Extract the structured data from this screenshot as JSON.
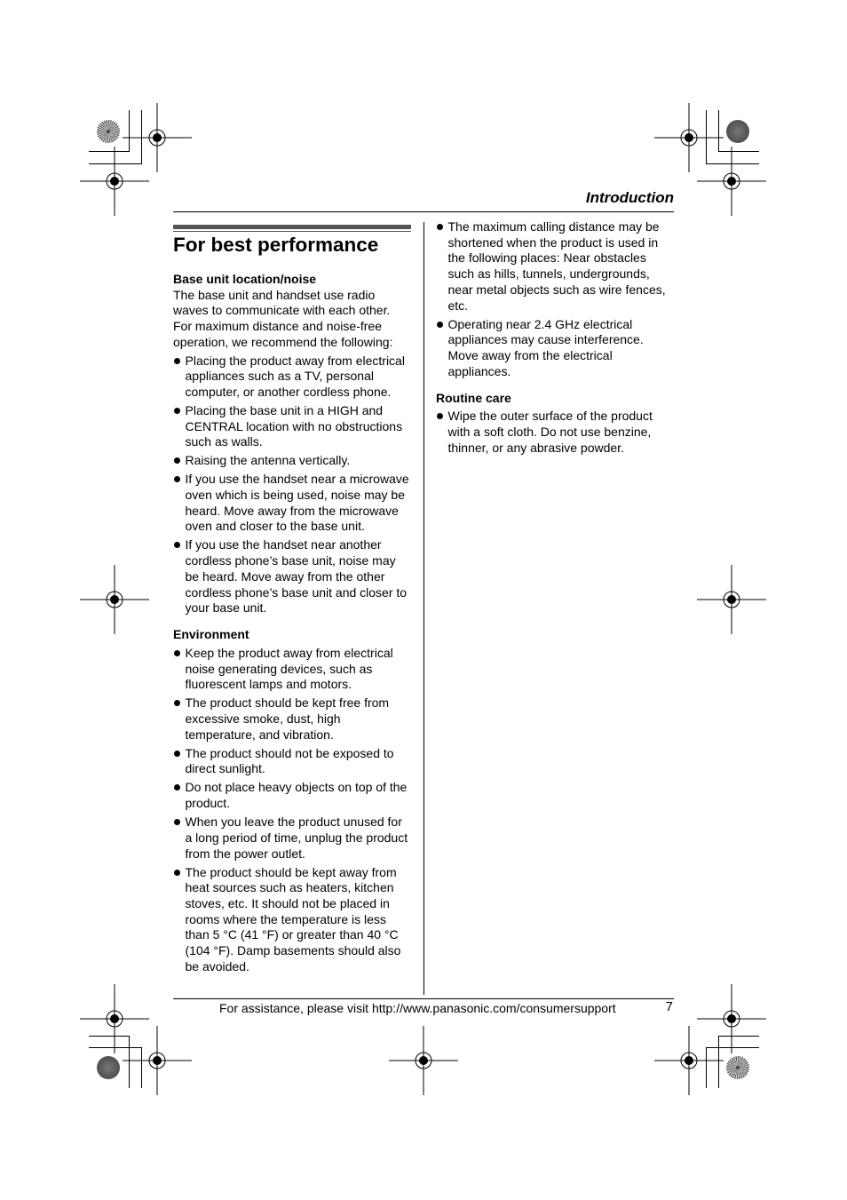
{
  "header": {
    "section_title": "Introduction"
  },
  "page_title": "For best performance",
  "left_column": {
    "base_unit": {
      "heading": "Base unit location/noise",
      "intro": "The base unit and handset use radio waves to communicate with each other. For maximum distance and noise-free operation, we recommend the following:",
      "bullets": [
        "Placing the product away from electrical appliances such as a TV, personal computer, or another cordless phone.",
        "Placing the base unit in a HIGH and CENTRAL location with no obstructions such as walls.",
        "Raising the antenna vertically.",
        "If you use the handset near a microwave oven which is being used, noise may be heard. Move away from the microwave oven and closer to the base unit.",
        "If you use the handset near another cordless phone’s base unit, noise may be heard. Move away from the other cordless phone’s base unit and closer to your base unit."
      ]
    },
    "environment": {
      "heading": "Environment",
      "bullets": [
        "Keep the product away from electrical noise generating devices, such as fluorescent lamps and motors.",
        "The product should be kept free from excessive smoke, dust, high temperature, and vibration.",
        "The product should not be exposed to direct sunlight.",
        "Do not place heavy objects on top of the product.",
        "When you leave the product unused for a long period of time, unplug the product from the power outlet.",
        "The product should be kept away from heat sources such as heaters, kitchen stoves, etc. It should not be placed in rooms where the temperature is less than 5 °C (41 °F) or greater than 40 °C (104 °F). Damp basements should also be avoided."
      ]
    }
  },
  "right_column": {
    "bullets": [
      "The maximum calling distance may be shortened when the product is used in the following places: Near obstacles such as hills, tunnels, undergrounds, near metal objects such as wire fences, etc.",
      "Operating near 2.4 GHz electrical appliances may cause interference. Move away from the electrical appliances."
    ],
    "routine_care": {
      "heading": "Routine care",
      "bullets": [
        "Wipe the outer surface of the product with a soft cloth. Do not use benzine, thinner, or any abrasive powder."
      ]
    }
  },
  "footer": {
    "assistance_text": "For assistance, please visit http://www.panasonic.com/consumersupport",
    "page_number": "7"
  },
  "print_marks": {
    "registration_icon": "crosshair-target-icon",
    "color_disc_icons": [
      "sunburst-disc-icon",
      "gray-disc-icon"
    ]
  }
}
